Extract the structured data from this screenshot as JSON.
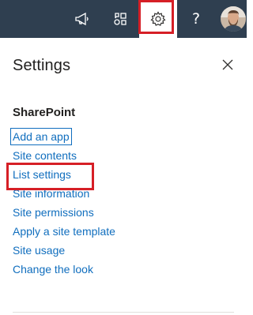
{
  "topbar": {
    "buttons": [
      {
        "icon": "megaphone-icon"
      },
      {
        "icon": "feedback-shapes-icon"
      },
      {
        "icon": "gear-icon",
        "selected": true
      },
      {
        "icon": "help-icon",
        "glyph": "?"
      }
    ],
    "avatar": {
      "icon": "user-avatar"
    }
  },
  "panel": {
    "title": "Settings",
    "close_icon": "close-icon",
    "section": {
      "heading": "SharePoint",
      "links": [
        "Add an app",
        "Site contents",
        "List settings",
        "Site information",
        "Site permissions",
        "Apply a site template",
        "Site usage",
        "Change the look"
      ]
    }
  },
  "colors": {
    "topbar_bg": "#2f3f50",
    "link": "#106ebe",
    "highlight": "#d61f26",
    "title_text": "#201f1e"
  }
}
